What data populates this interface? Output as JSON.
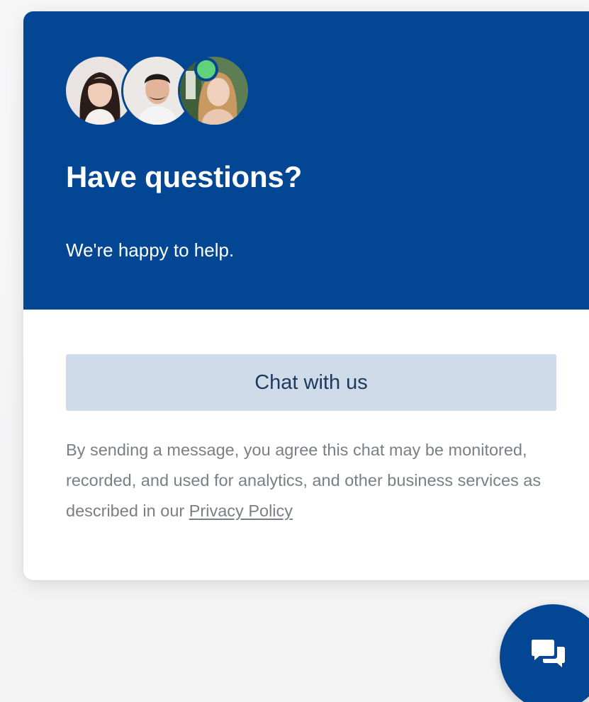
{
  "colors": {
    "brand": "#034694",
    "button_bg": "#cfdbe8",
    "online": "#5fd27a",
    "muted_text": "#7a7f86"
  },
  "header": {
    "avatars": [
      {
        "icon": "agent-avatar-woman-dark-hair"
      },
      {
        "icon": "agent-avatar-man"
      },
      {
        "icon": "agent-avatar-woman-blonde"
      }
    ],
    "online_status_icon": "online-status-dot",
    "title": "Have questions?",
    "subtitle": "We're happy to help."
  },
  "body": {
    "chat_button_label": "Chat with us",
    "disclaimer_text": "By sending a message, you agree this chat may be monitored, recorded, and used for analytics, and other business services as described in our ",
    "privacy_link_label": "Privacy Policy"
  },
  "launcher": {
    "icon": "chat-bubbles-icon"
  }
}
